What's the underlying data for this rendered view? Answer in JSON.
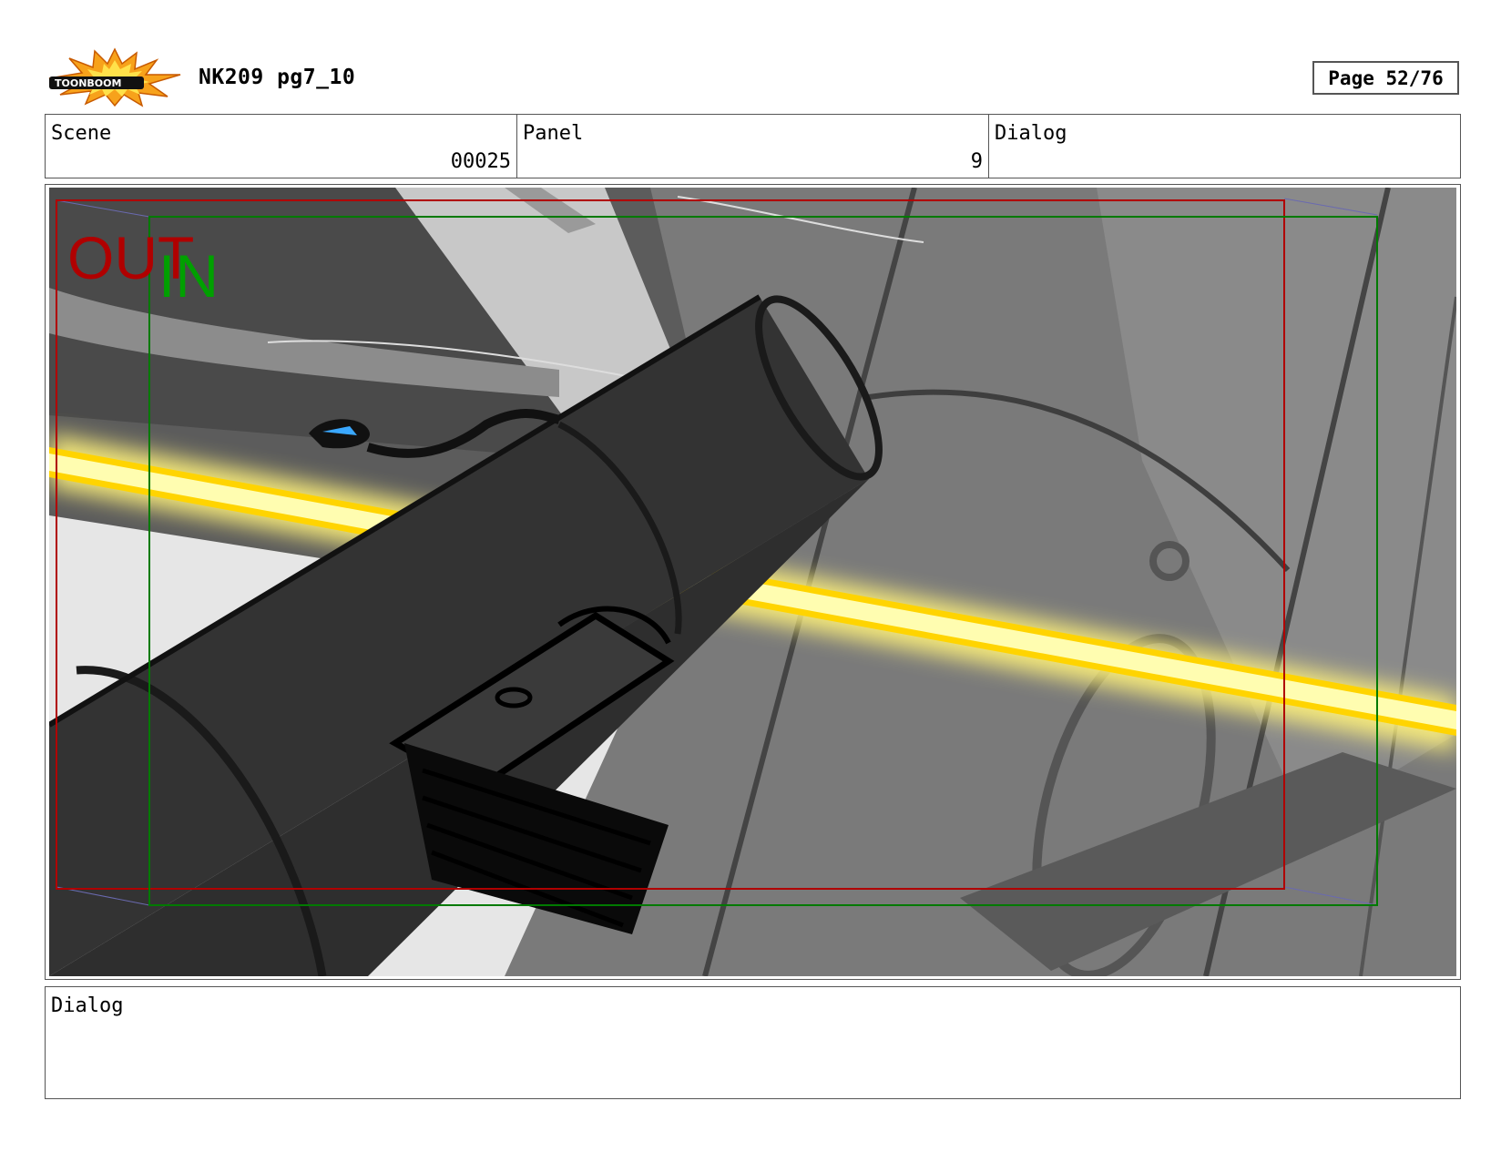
{
  "header": {
    "logo_text": "TOONBOOM",
    "title": "NK209 pg7_10",
    "page": "Page 52/76"
  },
  "info": {
    "scene_label": "Scene",
    "scene_value": "00025",
    "panel_label": "Panel",
    "panel_value": "9",
    "dialog_label": "Dialog",
    "dialog_value": ""
  },
  "panel": {
    "out_label": "OUT",
    "in_label": "IN",
    "out_color": "#b00000",
    "in_color": "#00a000"
  },
  "dialog": {
    "label": "Dialog",
    "text": ""
  }
}
